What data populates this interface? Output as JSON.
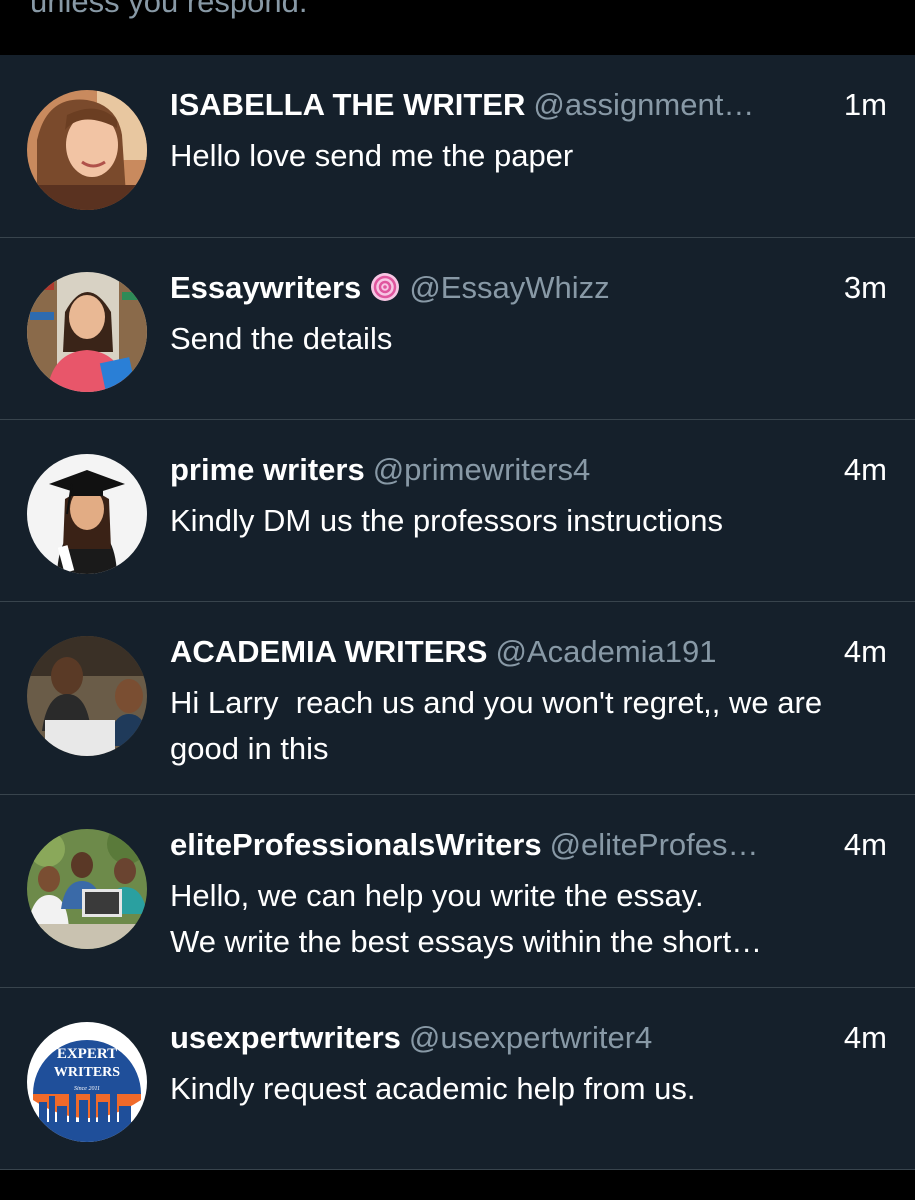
{
  "banner": {
    "text": "unless you respond."
  },
  "conversations": [
    {
      "name": "ISABELLA THE WRITER",
      "handle": "@assignment…",
      "time": "1m",
      "message": "Hello love send me the paper",
      "avatar_icon": "woman-selfie-avatar"
    },
    {
      "name": "Essaywriters",
      "handle": "@EssayWhizz",
      "time": "3m",
      "message": "Send the details",
      "avatar_icon": "student-with-books-avatar",
      "badge_icon": "pink-swirl-emoji"
    },
    {
      "name": "prime writers",
      "handle": "@primewriters4",
      "time": "4m",
      "message": "Kindly DM us the professors instructions",
      "avatar_icon": "graduate-cap-avatar"
    },
    {
      "name": "ACADEMIA WRITERS",
      "handle": "@Academia191",
      "time": "4m",
      "message": "Hi Larry  reach us and you won't regret,, we are  good in this",
      "avatar_icon": "students-laptop-avatar"
    },
    {
      "name": "eliteProfessionalsWriters",
      "handle": "@eliteProfes…",
      "time": "4m",
      "message": "Hello, we can help you write the essay.\nWe write the best essays within the short…",
      "avatar_icon": "group-study-avatar"
    },
    {
      "name": "usexpertwriters",
      "handle": "@usexpertwriter4",
      "time": "4m",
      "message": "Kindly request academic help from us.",
      "avatar_icon": "expert-writers-logo",
      "avatar_text": [
        "EXPERT",
        "WRITERS",
        "Since 2011"
      ]
    }
  ],
  "colors": {
    "background": "#15202b",
    "divider": "#38444d",
    "primary_text": "#ffffff",
    "secondary_text": "#8899a6",
    "logo_blue": "#1f4f9a",
    "logo_orange": "#f06a2a"
  }
}
